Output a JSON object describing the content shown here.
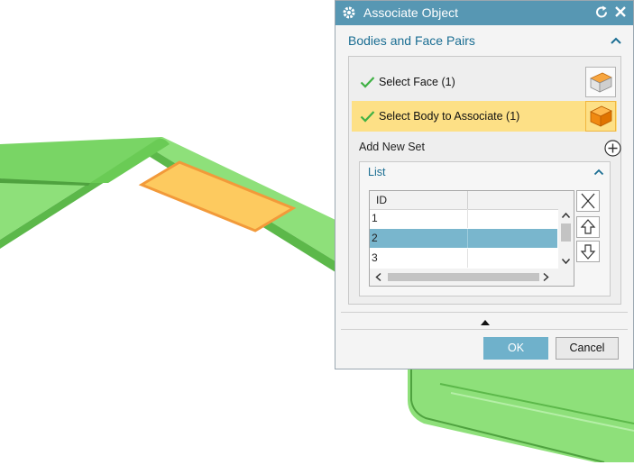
{
  "colors": {
    "titlebar": "#5797b3",
    "accent_text": "#1b6e93",
    "highlight": "#fde086",
    "selected_row": "#79b6cd",
    "ok_button": "#6fb1cb",
    "model_green": "#8ee07a",
    "model_face": "#fdca5f",
    "model_face_edge": "#f29a3a"
  },
  "dialog": {
    "title": "Associate Object",
    "title_icons": [
      "gear-icon",
      "reset-icon",
      "close-icon"
    ],
    "group": {
      "label": "Bodies and Face Pairs",
      "rows": [
        {
          "label": "Select Face (1)",
          "icon": "face-select-icon",
          "checked": true
        },
        {
          "label": "Select Body to Associate (1)",
          "icon": "body-select-icon",
          "checked": true
        }
      ],
      "add_new_set": "Add New Set",
      "list": {
        "label": "List",
        "columns": [
          "ID",
          ""
        ],
        "rows": [
          "1",
          "2",
          "3"
        ],
        "selected_index": 1
      }
    },
    "buttons": {
      "ok": "OK",
      "cancel": "Cancel"
    }
  }
}
